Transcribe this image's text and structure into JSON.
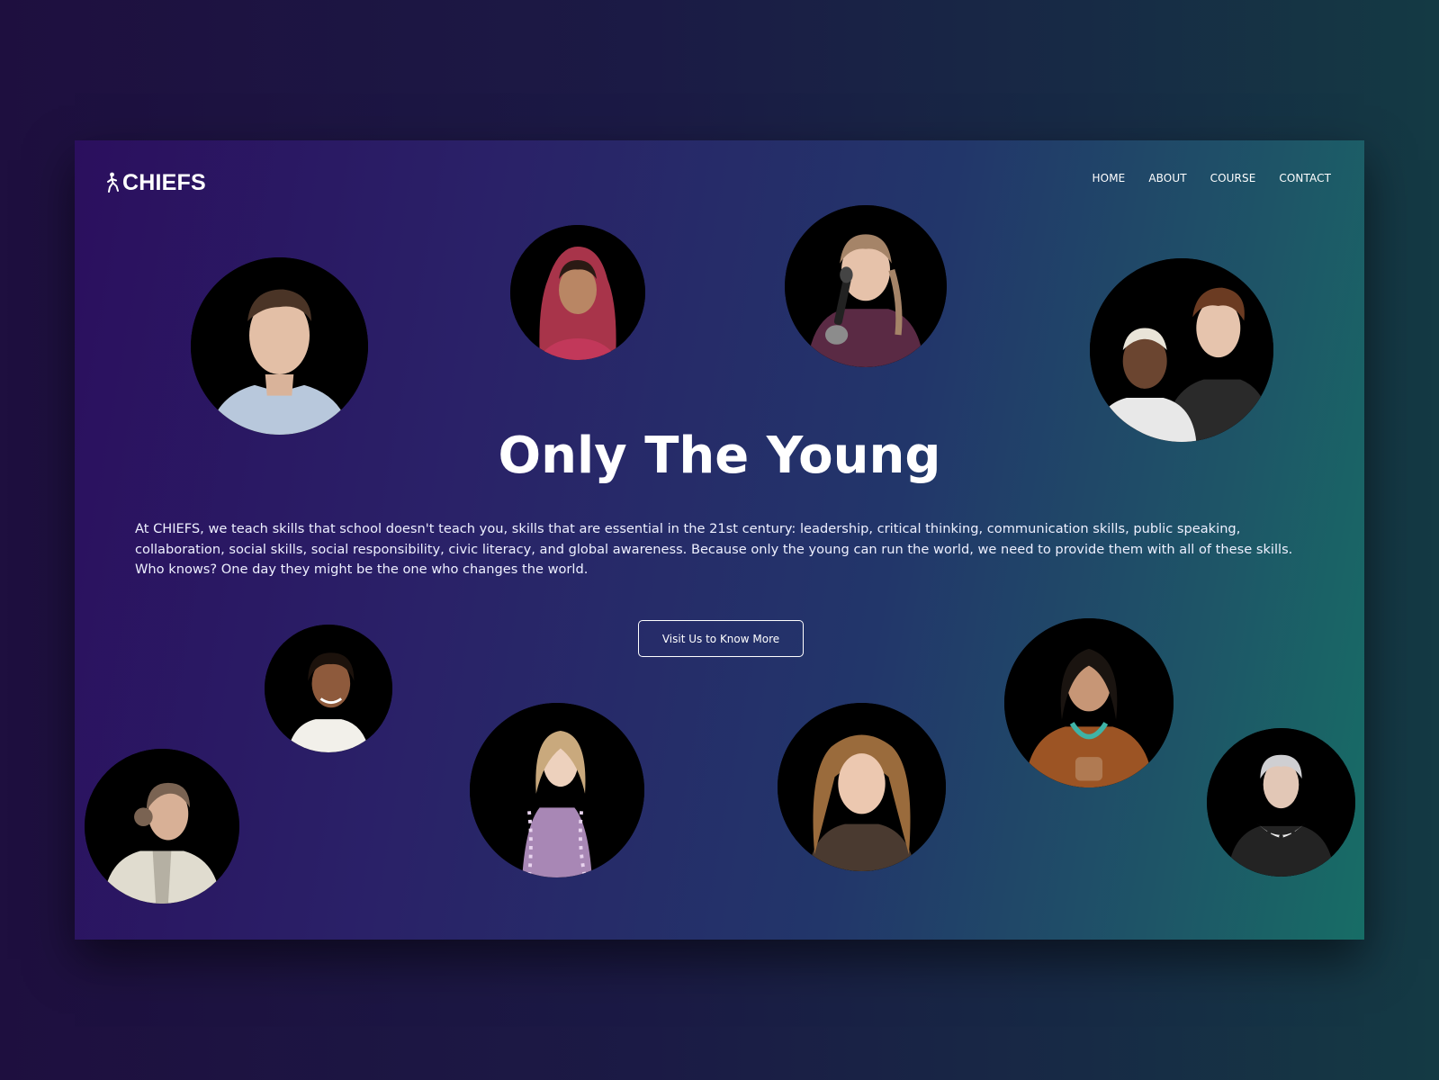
{
  "brand": {
    "name": "CHIEFS",
    "logo_icon": "running-figure-icon"
  },
  "nav": {
    "items": [
      {
        "label": "HOME"
      },
      {
        "label": "ABOUT"
      },
      {
        "label": "COURSE"
      },
      {
        "label": "CONTACT"
      }
    ]
  },
  "hero": {
    "title": "Only The Young",
    "description": "At CHIEFS, we teach skills that school doesn't teach you, skills that are essential in the 21st century: leadership, critical thinking, communication skills, public speaking, collaboration, social skills, social responsibility, civic literacy, and global awareness. Because only the young can run the world, we need to provide them with all of these skills. Who knows? One day they might be the one who changes the world.",
    "cta_label": "Visit Us to Know More"
  },
  "colors": {
    "frame_gradient": [
      "#2b0f5e",
      "#2a2168",
      "#22366a",
      "#1e5567",
      "#176d66"
    ],
    "outer_gradient": [
      "#1e0f3f",
      "#143a44"
    ],
    "text": "#ffffff",
    "portrait_background": "#000000"
  }
}
